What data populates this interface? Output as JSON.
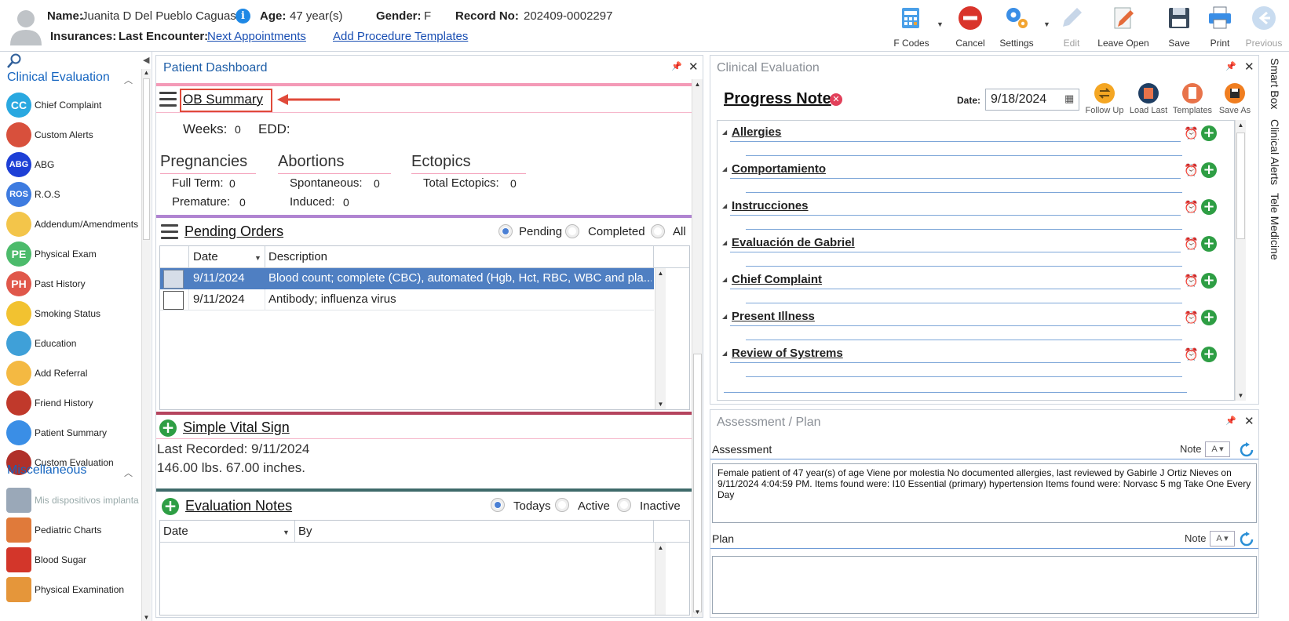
{
  "patient": {
    "name_label": "Name:",
    "name": "Juanita D Del Pueblo Caguas",
    "age_label": "Age:",
    "age": "47 year(s)",
    "gender_label": "Gender:",
    "gender": "F",
    "record_label": "Record No:",
    "record": "202409-0002297",
    "insurances_label": "Insurances:",
    "last_encounter_label": "Last Encounter:",
    "next_appointments": "Next Appointments",
    "add_procedure_templates": "Add Procedure Templates",
    "info_glyph": "i"
  },
  "toolbar": {
    "fcodes": "F Codes",
    "cancel": "Cancel",
    "settings": "Settings",
    "edit": "Edit",
    "leave_open": "Leave Open",
    "save": "Save",
    "print": "Print",
    "previous": "Previous"
  },
  "sidebar": {
    "section1": "Clinical Evaluation",
    "section2": "Miscellaneous",
    "items": [
      {
        "label": "Chief Complaint",
        "abbr": "CC",
        "color": "#29a8e0"
      },
      {
        "label": "Custom Alerts",
        "abbr": "",
        "color": "#d8503c"
      },
      {
        "label": "ABG",
        "abbr": "ABG",
        "color": "#1d3fd6"
      },
      {
        "label": "R.O.S",
        "abbr": "ROS",
        "color": "#3d7be0"
      },
      {
        "label": "Addendum/Amendments",
        "abbr": "",
        "color": "#f3c54a"
      },
      {
        "label": "Physical Exam",
        "abbr": "PE",
        "color": "#4cbb6b"
      },
      {
        "label": "Past History",
        "abbr": "PH",
        "color": "#e0574a"
      },
      {
        "label": "Smoking Status",
        "abbr": "",
        "color": "#f2c230"
      },
      {
        "label": "Education",
        "abbr": "",
        "color": "#3fa0d8"
      },
      {
        "label": "Add Referral",
        "abbr": "",
        "color": "#f4b942"
      },
      {
        "label": "Friend History",
        "abbr": "",
        "color": "#c0392b"
      },
      {
        "label": "Patient Summary",
        "abbr": "",
        "color": "#3a8ee6"
      },
      {
        "label": "Custom Evaluation",
        "abbr": "",
        "color": "#b0302a"
      }
    ],
    "misc_items": [
      {
        "label": "Mis dispositivos implanta",
        "color": "#9aa8b8"
      },
      {
        "label": "Pediatric Charts",
        "color": "#e07a3a"
      },
      {
        "label": "Blood Sugar",
        "color": "#d3362a"
      },
      {
        "label": "Physical Examination",
        "color": "#e5963a"
      }
    ]
  },
  "dashboard": {
    "title": "Patient Dashboard",
    "ob_summary": "OB Summary",
    "weeks_label": "Weeks:",
    "weeks": "0",
    "edd_label": "EDD:",
    "pregnancies": "Pregnancies",
    "full_term_label": "Full Term:",
    "full_term": "0",
    "premature_label": "Premature:",
    "premature": "0",
    "abortions": "Abortions",
    "spontaneous_label": "Spontaneous:",
    "spontaneous": "0",
    "induced_label": "Induced:",
    "induced": "0",
    "ectopics": "Ectopics",
    "total_ectopics_label": "Total Ectopics:",
    "total_ectopics": "0",
    "pending_orders": "Pending Orders",
    "radio_pending": "Pending",
    "radio_completed": "Completed",
    "radio_all": "All",
    "col_date": "Date",
    "col_description": "Description",
    "orders": [
      {
        "date": "9/11/2024",
        "description": "Blood count; complete (CBC), automated (Hgb, Hct, RBC, WBC and pla..."
      },
      {
        "date": "9/11/2024",
        "description": "Antibody; influenza virus"
      }
    ],
    "vital_title": "Simple Vital Sign",
    "last_recorded": "Last Recorded: 9/11/2024",
    "vitals_values": "146.00 lbs. 67.00 inches.",
    "eval_notes": "Evaluation Notes",
    "radio_todays": "Todays",
    "radio_active": "Active",
    "radio_inactive": "Inactive",
    "col_by": "By"
  },
  "clinical": {
    "title": "Clinical Evaluation",
    "progress_note": "Progress Note",
    "date_label": "Date:",
    "date_value": "9/18/2024",
    "follow_up": "Follow Up",
    "load_last": "Load Last",
    "templates": "Templates",
    "save_as": "Save As",
    "sections": [
      "Allergies",
      "Comportamiento",
      "Instrucciones",
      "Evaluación de Gabriel",
      "Chief Complaint",
      "Present Illness",
      "Review of Systrems"
    ]
  },
  "assessment": {
    "title": "Assessment / Plan",
    "assessment_label": "Assessment",
    "note_label": "Note",
    "assessment_text": "Female patient of 47 year(s) of age Viene por molestia     No documented allergies, last reviewed by Gabirle J Ortiz Nieves on 9/11/2024 4:04:59 PM.     Items found were:  I10 Essential (primary) hypertension  Items found were:  Norvasc 5 mg Take One Every Day",
    "plan_label": "Plan",
    "plan_note_label": "Note"
  },
  "right_tabs": [
    "Smart Box",
    "Clinical Alerts",
    "Tele Medicine"
  ]
}
